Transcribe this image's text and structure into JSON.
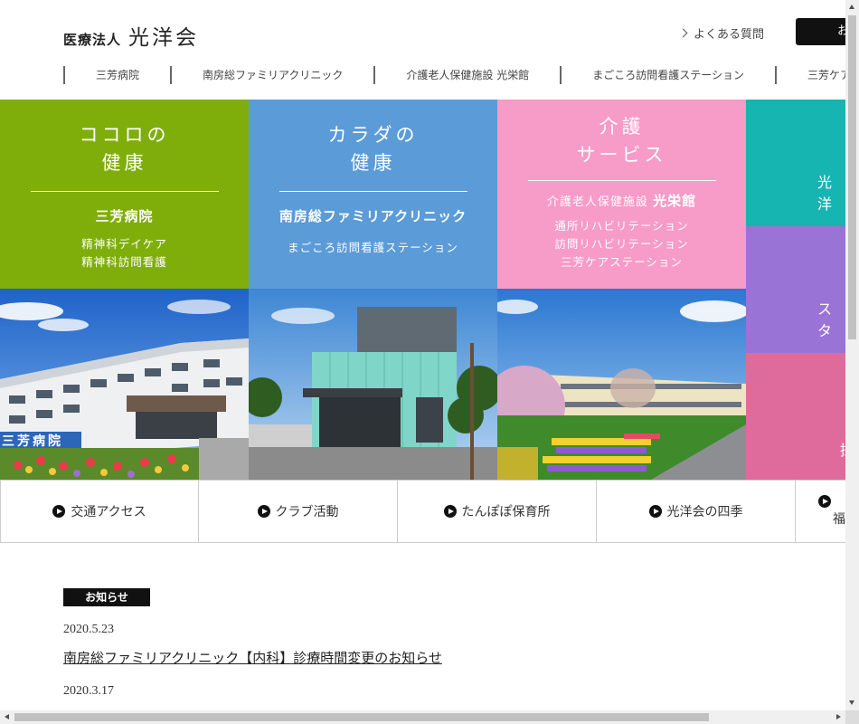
{
  "header": {
    "logo_small": "医療法人",
    "logo_big": "光洋会",
    "faq_label": "よくある質問",
    "contact_label": "お"
  },
  "gnav": [
    {
      "label": "三芳病院"
    },
    {
      "label": "南房総ファミリアクリニック"
    },
    {
      "label": "介護老人保健施設 光栄館"
    },
    {
      "label": "まごころ訪問看護ステーション"
    },
    {
      "label": "三芳ケアス"
    }
  ],
  "tiles": {
    "mind": {
      "head1": "ココロの",
      "head2": "健康",
      "facility": "三芳病院",
      "sub1": "精神科デイケア",
      "sub2": "精神科訪問看護",
      "color": "#7fae0b"
    },
    "body": {
      "head1": "カラダの",
      "head2": "健康",
      "facility": "南房総ファミリアクリニック",
      "sub1": "まごころ訪問看護ステーション",
      "color": "#5b9bd8"
    },
    "care": {
      "head1": "介護",
      "head2": "サービス",
      "facility_prefix": "介護老人保健施設",
      "facility_name": "光栄館",
      "sub1": "通所リハビリテーション",
      "sub2": "訪問リハビリテーション",
      "sub3": "三芳ケアステーション",
      "color": "#f79bc8"
    }
  },
  "side_tiles": [
    {
      "label": "光洋",
      "color": "#17b5b2"
    },
    {
      "label": "スタ",
      "color": "#9a73d6"
    },
    {
      "label": "採",
      "color": "#df6b9d"
    }
  ],
  "photos": {
    "hospital_sign": "三芳病院"
  },
  "link_bar": [
    {
      "label": "交通アクセス"
    },
    {
      "label": "クラブ活動"
    },
    {
      "label": "たんぽぽ保育所"
    },
    {
      "label": "光洋会の四季"
    },
    {
      "label": "福"
    }
  ],
  "news": {
    "section_label": "お知らせ",
    "items": [
      {
        "date": "2020.5.23",
        "title": "南房総ファミリアクリニック【内科】診療時間変更のお知らせ"
      },
      {
        "date": "2020.3.17"
      }
    ]
  }
}
